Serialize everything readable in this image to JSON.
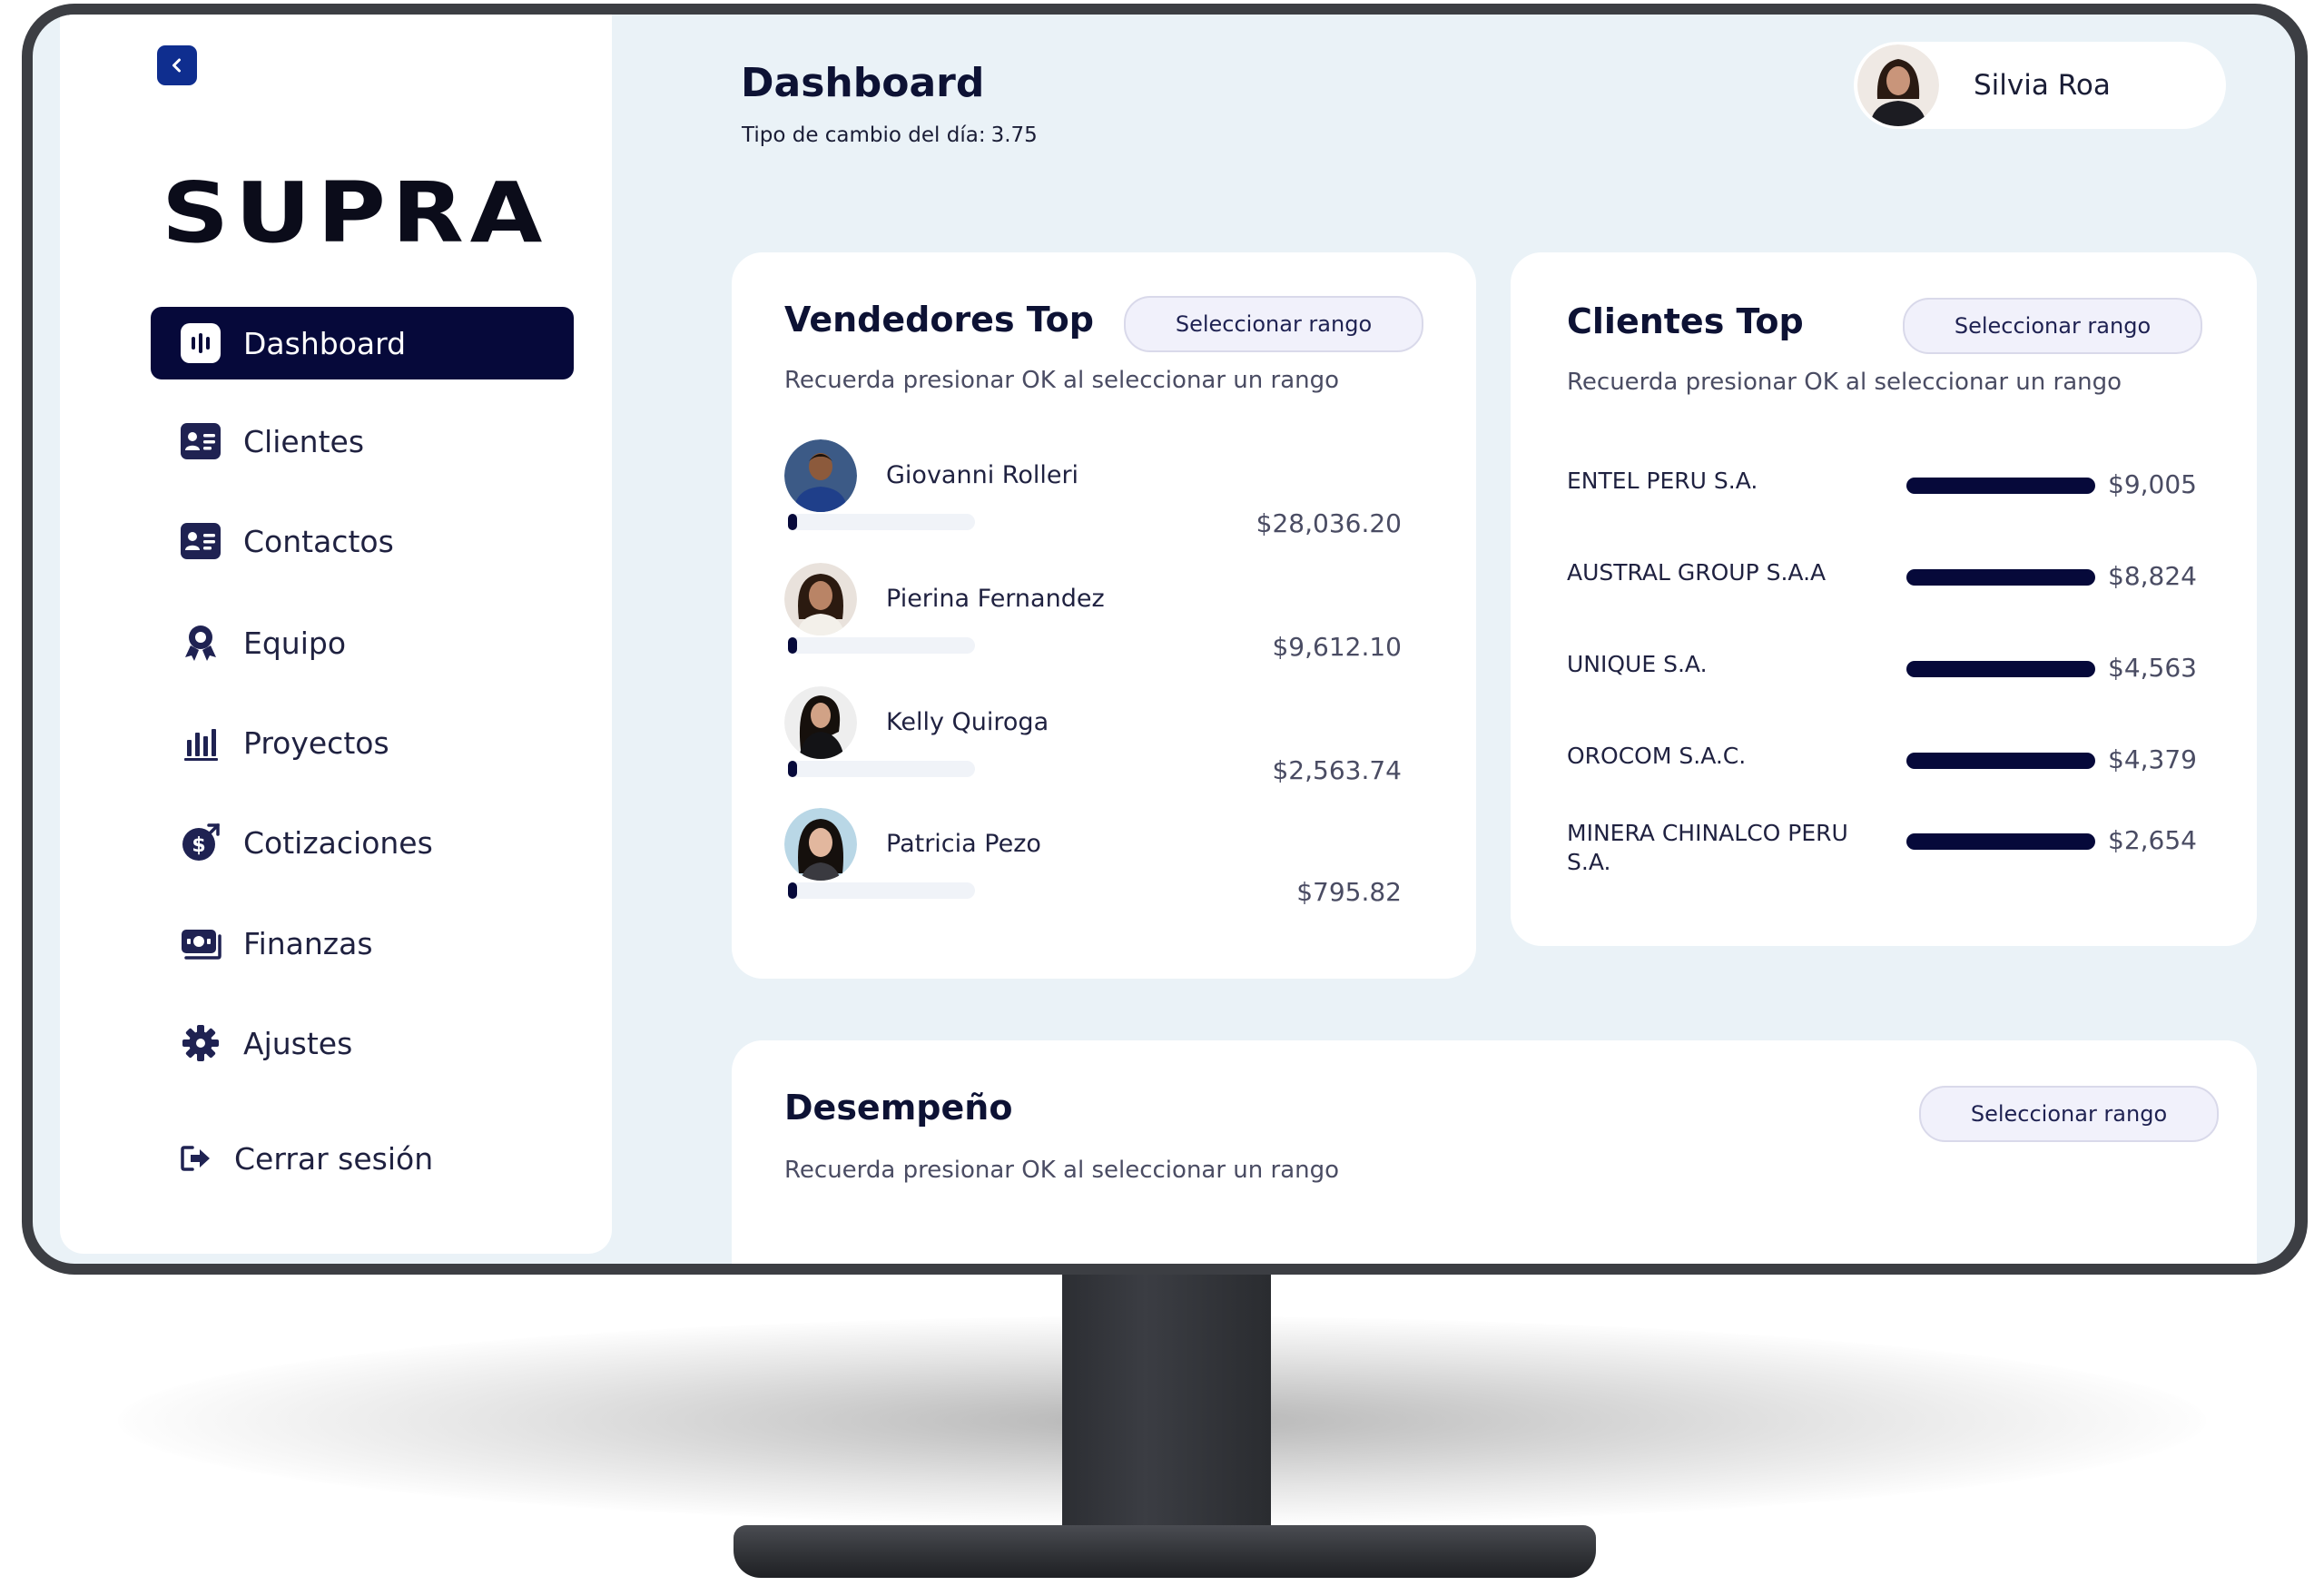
{
  "sidebar": {
    "brand": "SUPRA",
    "items": [
      {
        "label": "Dashboard",
        "icon": "dashboard-icon",
        "active": true
      },
      {
        "label": "Clientes",
        "icon": "contact-card-icon"
      },
      {
        "label": "Contactos",
        "icon": "contact-card-icon"
      },
      {
        "label": "Equipo",
        "icon": "award-icon"
      },
      {
        "label": "Proyectos",
        "icon": "bar-chart-icon"
      },
      {
        "label": "Cotizaciones",
        "icon": "money-icon"
      },
      {
        "label": "Finanzas",
        "icon": "cash-icon"
      },
      {
        "label": "Ajustes",
        "icon": "gear-icon"
      }
    ],
    "logout_label": "Cerrar sesión"
  },
  "header": {
    "title": "Dashboard",
    "rate_label": "Tipo de cambio del día:",
    "rate_value": "3.75",
    "user_name": "Silvia Roa"
  },
  "vendedores": {
    "title": "Vendedores Top",
    "range_label": "Seleccionar rango",
    "hint": "Recuerda presionar OK al seleccionar un rango",
    "rows": [
      {
        "name": "Giovanni Rolleri",
        "value": "$28,036.20",
        "progress": 0.05
      },
      {
        "name": "Pierina Fernandez",
        "value": "$9,612.10",
        "progress": 0.05
      },
      {
        "name": "Kelly Quiroga",
        "value": "$2,563.74",
        "progress": 0.05
      },
      {
        "name": "Patricia Pezo",
        "value": "$795.82",
        "progress": 0.05
      }
    ]
  },
  "clientes": {
    "title": "Clientes Top",
    "range_label": "Seleccionar rango",
    "hint": "Recuerda presionar OK al seleccionar un rango",
    "rows": [
      {
        "name": "ENTEL PERU S.A.",
        "value": "$9,005"
      },
      {
        "name": "AUSTRAL GROUP S.A.A",
        "value": "$8,824"
      },
      {
        "name": "UNIQUE S.A.",
        "value": "$4,563"
      },
      {
        "name": "OROCOM S.A.C.",
        "value": "$4,379"
      },
      {
        "name": "MINERA CHINALCO PERU S.A.",
        "value": "$2,654"
      }
    ]
  },
  "desempeno": {
    "title": "Desempeño",
    "range_label": "Seleccionar rango",
    "hint": "Recuerda presionar OK al seleccionar un rango"
  },
  "colors": {
    "navy": "#06093a",
    "accent_blue": "#0f2e8f",
    "background": "#eaf2f7"
  }
}
